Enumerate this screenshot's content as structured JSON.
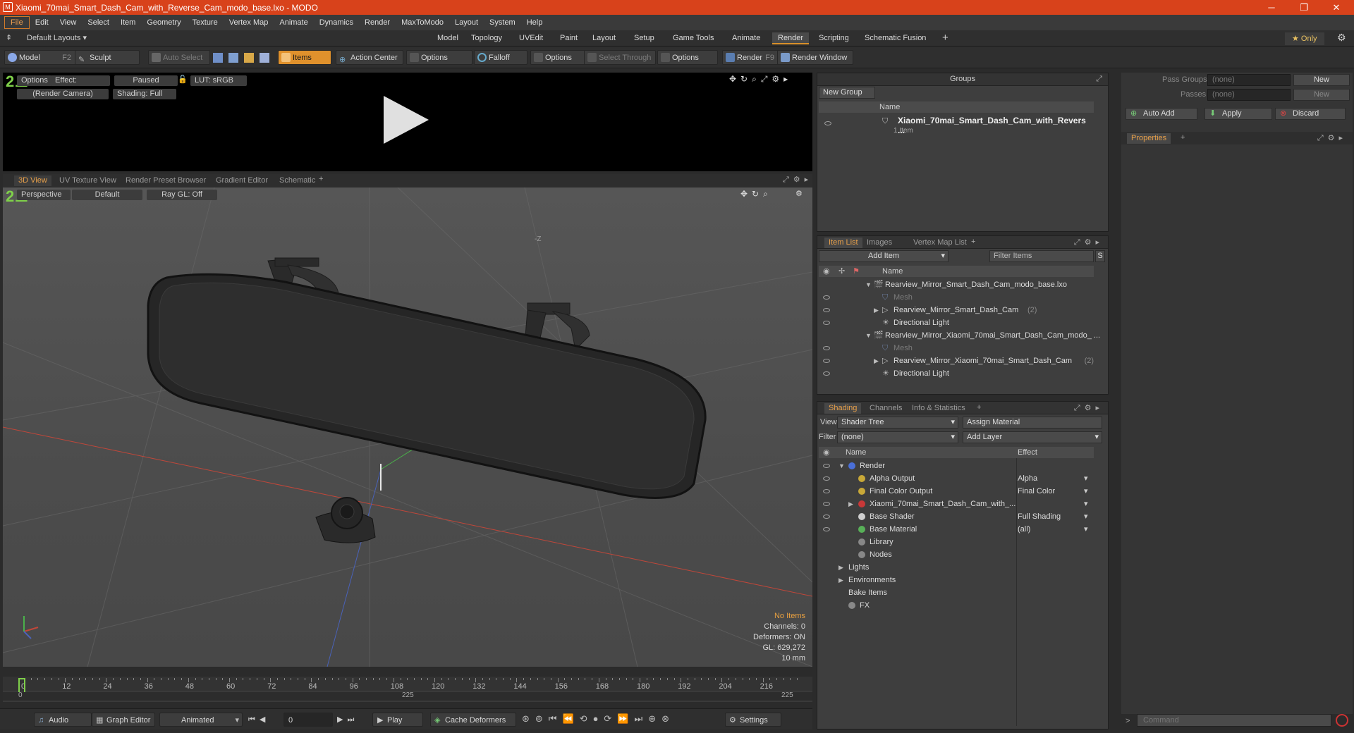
{
  "window": {
    "title": "Xiaomi_70mai_Smart_Dash_Cam_with_Reverse_Cam_modo_base.lxo - MODO",
    "minimize": "─",
    "restore": "❐",
    "close": "✕"
  },
  "menu": [
    "File",
    "Edit",
    "View",
    "Select",
    "Item",
    "Geometry",
    "Texture",
    "Vertex Map",
    "Animate",
    "Dynamics",
    "Render",
    "MaxToModo",
    "Layout",
    "System",
    "Help"
  ],
  "layoutbar": {
    "default_layouts": "Default Layouts ▾",
    "tabs": [
      "Model",
      "Topology",
      "UVEdit",
      "Paint",
      "Layout",
      "Setup",
      "Game Tools",
      "Animate",
      "Render",
      "Scripting",
      "Schematic Fusion"
    ],
    "active_tab": "Render",
    "add": "+",
    "only": "★  Only"
  },
  "toolbar": {
    "model": "Model",
    "model_key": "F2",
    "sculpt": "Sculpt",
    "auto_select": "Auto Select",
    "items": "Items",
    "action_center": "Action Center",
    "options1": "Options",
    "falloff": "Falloff",
    "options2": "Options",
    "select_through": "Select Through",
    "options3": "Options",
    "render": "Render",
    "render_key": "F9",
    "render_window": "Render Window"
  },
  "render_preview": {
    "options": "Options",
    "effect": "Effect: (Shadi...",
    "paused": "Paused",
    "lut": "LUT: sRGB",
    "camera": "(Render Camera)",
    "shading": "Shading: Full"
  },
  "viewport_tabs": [
    "3D View",
    "UV Texture View",
    "Render Preset Browser",
    "Gradient Editor",
    "Schematic"
  ],
  "viewport": {
    "perspective": "Perspective",
    "default": "Default",
    "raygl": "Ray GL: Off",
    "info": {
      "no_items": "No Items",
      "channels": "Channels: 0",
      "deformers": "Deformers: ON",
      "gl": "GL: 629,272",
      "units": "10 mm"
    },
    "axis_label": "-Z"
  },
  "timeline": {
    "ticks": [
      "0",
      "12",
      "24",
      "36",
      "48",
      "60",
      "72",
      "84",
      "96",
      "108",
      "120",
      "132",
      "144",
      "156",
      "168",
      "180",
      "192",
      "204",
      "216"
    ],
    "start": "0",
    "mid": "225",
    "end": "225"
  },
  "bottombar": {
    "audio": "Audio",
    "graph_editor": "Graph Editor",
    "animated": "Animated",
    "frame": "0",
    "play": "Play",
    "cache_deformers": "Cache Deformers",
    "settings": "Settings"
  },
  "groups": {
    "title": "Groups",
    "new_group": "New Group",
    "col_name": "Name",
    "item_name": "Xiaomi_70mai_Smart_Dash_Cam_with_Revers ...",
    "item_sub": "1 Item"
  },
  "passes": {
    "pass_groups_label": "Pass Groups",
    "pass_groups_value": "(none)",
    "new": "New",
    "passes_label": "Passes",
    "passes_value": "(none)",
    "new2": "New",
    "auto_add": "Auto Add",
    "apply": "Apply",
    "discard": "Discard",
    "properties": "Properties"
  },
  "itemlist": {
    "tabs": [
      "Item List",
      "Images",
      "Vertex Map List"
    ],
    "add_item": "Add Item",
    "filter_items": "Filter Items",
    "col_name": "Name",
    "rows": [
      {
        "label": "Rearview_Mirror_Smart_Dash_Cam_modo_base.lxo",
        "level": 0,
        "arrow": "▼",
        "dim": false,
        "count": ""
      },
      {
        "label": "Mesh",
        "level": 1,
        "arrow": "",
        "dim": true,
        "count": ""
      },
      {
        "label": "Rearview_Mirror_Smart_Dash_Cam",
        "level": 1,
        "arrow": "▶",
        "dim": false,
        "count": "(2)"
      },
      {
        "label": "Directional Light",
        "level": 1,
        "arrow": "",
        "dim": false,
        "count": ""
      },
      {
        "label": "Rearview_Mirror_Xiaomi_70mai_Smart_Dash_Cam_modo_ ...",
        "level": 0,
        "arrow": "▼",
        "dim": false,
        "count": ""
      },
      {
        "label": "Mesh",
        "level": 1,
        "arrow": "",
        "dim": true,
        "count": ""
      },
      {
        "label": "Rearview_Mirror_Xiaomi_70mai_Smart_Dash_Cam",
        "level": 1,
        "arrow": "▶",
        "dim": false,
        "count": "(2)"
      },
      {
        "label": "Directional Light",
        "level": 1,
        "arrow": "",
        "dim": false,
        "count": ""
      }
    ]
  },
  "shading": {
    "tabs": [
      "Shading",
      "Channels",
      "Info & Statistics"
    ],
    "view_label": "View",
    "view_value": "Shader Tree",
    "assign_material": "Assign Material",
    "filter_label": "Filter",
    "filter_value": "(none)",
    "add_layer": "Add Layer",
    "col_name": "Name",
    "col_effect": "Effect",
    "rows": [
      {
        "label": "Render",
        "effect": "",
        "indent": 0,
        "arrow": "▼",
        "eye": true,
        "color": "#4a6fd8"
      },
      {
        "label": "Alpha Output",
        "effect": "Alpha",
        "indent": 1,
        "arrow": "",
        "eye": true,
        "color": "#c8a838"
      },
      {
        "label": "Final Color Output",
        "effect": "Final Color",
        "indent": 1,
        "arrow": "",
        "eye": true,
        "color": "#c8a838"
      },
      {
        "label": "Xiaomi_70mai_Smart_Dash_Cam_with_...",
        "effect": "",
        "indent": 1,
        "arrow": "▶",
        "eye": true,
        "color": "#c83838"
      },
      {
        "label": "Base Shader",
        "effect": "Full Shading",
        "indent": 1,
        "arrow": "",
        "eye": true,
        "color": "#cfcfcf"
      },
      {
        "label": "Base Material",
        "effect": "(all)",
        "indent": 1,
        "arrow": "",
        "eye": true,
        "color": "#58b058"
      },
      {
        "label": "Library",
        "effect": "",
        "indent": 1,
        "arrow": "",
        "eye": false,
        "color": "#888"
      },
      {
        "label": "Nodes",
        "effect": "",
        "indent": 1,
        "arrow": "",
        "eye": false,
        "color": "#888"
      },
      {
        "label": "Lights",
        "effect": "",
        "indent": 0,
        "arrow": "▶",
        "eye": false,
        "color": ""
      },
      {
        "label": "Environments",
        "effect": "",
        "indent": 0,
        "arrow": "▶",
        "eye": false,
        "color": ""
      },
      {
        "label": "Bake Items",
        "effect": "",
        "indent": 0,
        "arrow": "",
        "eye": false,
        "color": ""
      },
      {
        "label": "FX",
        "effect": "",
        "indent": 0,
        "arrow": "",
        "eye": false,
        "color": "#888"
      }
    ]
  },
  "command": {
    "placeholder": "Command"
  },
  "colors": {
    "accent": "#e0912c",
    "titlebar": "#d8421b",
    "active_tab": "#e8a04a"
  }
}
